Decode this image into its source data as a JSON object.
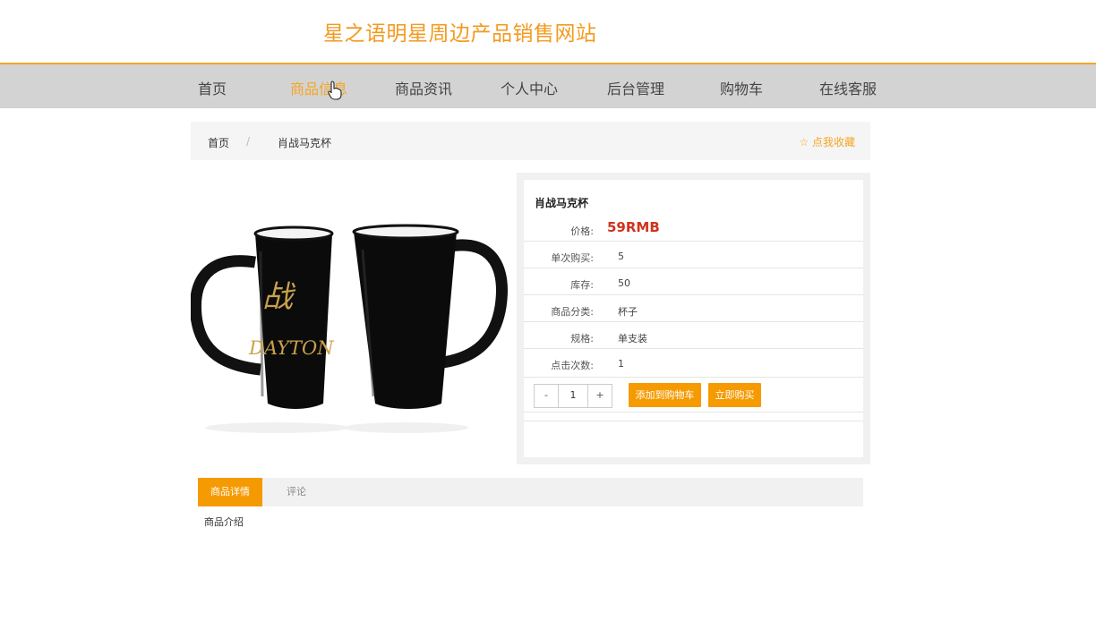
{
  "header": {
    "site_title": "星之语明星周边产品销售网站"
  },
  "nav": {
    "items": [
      {
        "label": "首页"
      },
      {
        "label": "商品信息"
      },
      {
        "label": "商品资讯"
      },
      {
        "label": "个人中心"
      },
      {
        "label": "后台管理"
      },
      {
        "label": "购物车"
      },
      {
        "label": "在线客服"
      }
    ],
    "active_index": 1
  },
  "breadcrumb": {
    "home": "首页",
    "separator": "/",
    "current": "肖战马克杯",
    "favorite": "☆ 点我收藏"
  },
  "product": {
    "image_text": "DAYTON",
    "name": "肖战马克杯",
    "price_label": "价格:",
    "price": "59RMB",
    "rows": [
      {
        "label": "单次购买:",
        "value": "5"
      },
      {
        "label": "库存:",
        "value": "50"
      },
      {
        "label": "商品分类:",
        "value": "杯子"
      },
      {
        "label": "规格:",
        "value": "单支装"
      },
      {
        "label": "点击次数:",
        "value": "1"
      }
    ],
    "quantity": {
      "minus": "-",
      "value": "1",
      "plus": "+"
    },
    "add_to_cart": "添加到购物车",
    "buy_now": "立即购买"
  },
  "tabs": {
    "items": [
      {
        "label": "商品详情"
      },
      {
        "label": "评论"
      }
    ],
    "active_index": 0,
    "content": "商品介绍"
  },
  "colors": {
    "accent": "#f5a623",
    "button": "#f59a00",
    "price": "#d0331c",
    "nav_bg": "#d3d3d3"
  }
}
